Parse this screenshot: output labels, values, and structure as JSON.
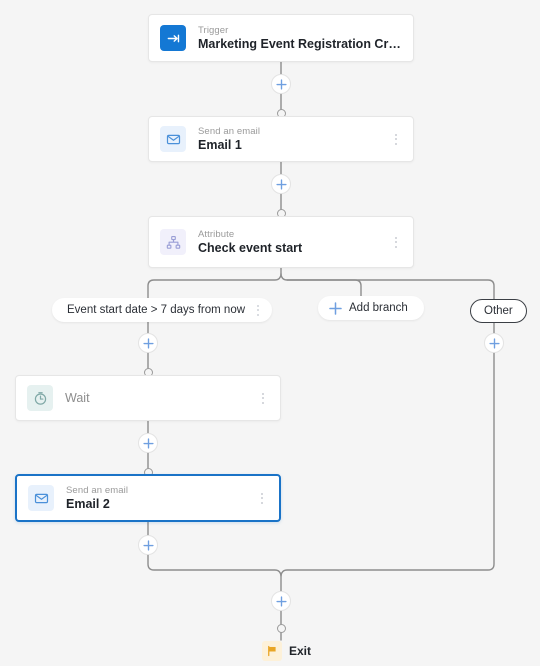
{
  "canvas": {
    "background_color": "#f5f5f5",
    "accent_color": "#1a73c7",
    "plus_color": "#6f9fe0",
    "edge_color": "#8d8d8d"
  },
  "nodes": [
    {
      "id": "trigger",
      "kicker": "Trigger",
      "title": "Marketing Event Registration Created",
      "icon": "trigger-arrow-icon",
      "icon_bg": "#1478d4",
      "icon_fg": "#ffffff",
      "has_kebab": false,
      "selected": false
    },
    {
      "id": "email1",
      "kicker": "Send an email",
      "title": "Email 1",
      "icon": "envelope-icon",
      "icon_bg": "#e8f1fc",
      "icon_fg": "#4a90d9",
      "has_kebab": true,
      "selected": false
    },
    {
      "id": "attribute",
      "kicker": "Attribute",
      "title": "Check event start",
      "icon": "hierarchy-icon",
      "icon_bg": "#f1f0fb",
      "icon_fg": "#9a9ed6",
      "has_kebab": true,
      "selected": false
    },
    {
      "id": "wait",
      "kicker": "",
      "title": "Wait",
      "icon": "timer-icon",
      "icon_bg": "#e6f1f0",
      "icon_fg": "#7fa8a6",
      "has_kebab": true,
      "selected": false,
      "muted_title": true
    },
    {
      "id": "email2",
      "kicker": "Send an email",
      "title": "Email 2",
      "icon": "envelope-icon",
      "icon_bg": "#e8f1fc",
      "icon_fg": "#4a90d9",
      "has_kebab": true,
      "selected": true
    }
  ],
  "branches": {
    "condition_label": "Event start date > 7 days from now",
    "add_branch_label": "Add branch",
    "other_label": "Other"
  },
  "exit": {
    "label": "Exit",
    "icon": "flag-icon",
    "icon_color": "#e9a626"
  },
  "add_buttons": [
    {
      "id": "add-after-trigger"
    },
    {
      "id": "add-after-email1"
    },
    {
      "id": "add-branch-left-top"
    },
    {
      "id": "add-branch-other-top"
    },
    {
      "id": "add-after-wait"
    },
    {
      "id": "add-after-email2"
    },
    {
      "id": "add-before-exit"
    }
  ]
}
